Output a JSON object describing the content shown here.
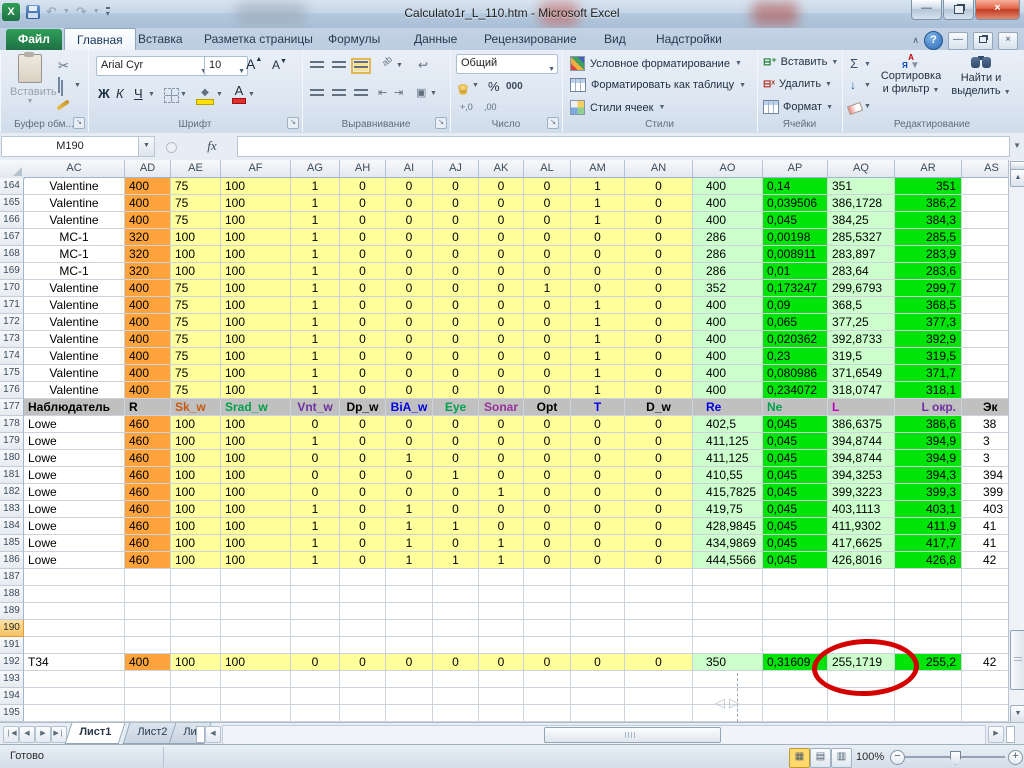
{
  "window": {
    "title": "Calculato1r_L_110.htm - Microsoft Excel"
  },
  "ribbon": {
    "tabs": [
      "Файл",
      "Главная",
      "Вставка",
      "Разметка страницы",
      "Формулы",
      "Данные",
      "Рецензирование",
      "Вид",
      "Надстройки"
    ],
    "clipboard": {
      "paste": "Вставить",
      "label": "Буфер обм..."
    },
    "font": {
      "name": "Arial Cyr",
      "size": "10",
      "bold": "Ж",
      "italic": "К",
      "underline": "Ч",
      "label": "Шрифт"
    },
    "alignment": {
      "label": "Выравнивание"
    },
    "number": {
      "format": "Общий",
      "percent": "%",
      "thousands": "000",
      "dec_inc": "+,0",
      "dec_dec": ",00",
      "label": "Число"
    },
    "styles": {
      "items": [
        "Условное форматирование",
        "Форматировать как таблицу",
        "Стили ячеек"
      ],
      "label": "Стили"
    },
    "cells": {
      "items": [
        "Вставить",
        "Удалить",
        "Формат"
      ],
      "label": "Ячейки"
    },
    "editing": {
      "sigma": "Σ",
      "sort": "Сортировка и фильтр",
      "find": "Найти и выделить",
      "label": "Редактирование"
    }
  },
  "formula_bar": {
    "name_box": "M190",
    "fx": "fx",
    "formula": ""
  },
  "sheet": {
    "columns": [
      "AC",
      "AD",
      "AE",
      "AF",
      "AG",
      "AH",
      "AI",
      "AJ",
      "AK",
      "AL",
      "AM",
      "AN",
      "AO",
      "AP",
      "AQ",
      "AR",
      "AS"
    ],
    "active_row": 190,
    "header_colors": [
      "#000000",
      "#000000",
      "#C45911",
      "#00A14B",
      "#7030A0",
      "#000000",
      "#0000E0",
      "#00A14B",
      "#99309A",
      "#000000",
      "#0000E0",
      "#000000",
      "#0000E0",
      "#00A14B",
      "#BF00BF",
      "#7030A0",
      "#000000"
    ],
    "rows": [
      {
        "n": 164,
        "a": "c",
        "v": [
          "Valentine",
          "400",
          "75",
          "100",
          "1",
          "0",
          "0",
          "0",
          "0",
          "0",
          "1",
          "0",
          "400",
          "0,14",
          "351",
          "351",
          ""
        ]
      },
      {
        "n": 165,
        "a": "c",
        "v": [
          "Valentine",
          "400",
          "75",
          "100",
          "1",
          "0",
          "0",
          "0",
          "0",
          "0",
          "1",
          "0",
          "400",
          "0,039506",
          "386,1728",
          "386,2",
          ""
        ]
      },
      {
        "n": 166,
        "a": "c",
        "v": [
          "Valentine",
          "400",
          "75",
          "100",
          "1",
          "0",
          "0",
          "0",
          "0",
          "0",
          "1",
          "0",
          "400",
          "0,045",
          "384,25",
          "384,3",
          ""
        ]
      },
      {
        "n": 167,
        "a": "c",
        "v": [
          "MC-1",
          "320",
          "100",
          "100",
          "1",
          "0",
          "0",
          "0",
          "0",
          "0",
          "0",
          "0",
          "286",
          "0,00198",
          "285,5327",
          "285,5",
          ""
        ]
      },
      {
        "n": 168,
        "a": "c",
        "v": [
          "MC-1",
          "320",
          "100",
          "100",
          "1",
          "0",
          "0",
          "0",
          "0",
          "0",
          "0",
          "0",
          "286",
          "0,008911",
          "283,897",
          "283,9",
          ""
        ]
      },
      {
        "n": 169,
        "a": "c",
        "v": [
          "MC-1",
          "320",
          "100",
          "100",
          "1",
          "0",
          "0",
          "0",
          "0",
          "0",
          "0",
          "0",
          "286",
          "0,01",
          "283,64",
          "283,6",
          ""
        ]
      },
      {
        "n": 170,
        "a": "c",
        "v": [
          "Valentine",
          "400",
          "75",
          "100",
          "1",
          "0",
          "0",
          "0",
          "0",
          "1",
          "0",
          "0",
          "352",
          "0,173247",
          "299,6793",
          "299,7",
          ""
        ]
      },
      {
        "n": 171,
        "a": "c",
        "v": [
          "Valentine",
          "400",
          "75",
          "100",
          "1",
          "0",
          "0",
          "0",
          "0",
          "0",
          "1",
          "0",
          "400",
          "0,09",
          "368,5",
          "368,5",
          ""
        ]
      },
      {
        "n": 172,
        "a": "c",
        "v": [
          "Valentine",
          "400",
          "75",
          "100",
          "1",
          "0",
          "0",
          "0",
          "0",
          "0",
          "1",
          "0",
          "400",
          "0,065",
          "377,25",
          "377,3",
          ""
        ]
      },
      {
        "n": 173,
        "a": "c",
        "v": [
          "Valentine",
          "400",
          "75",
          "100",
          "1",
          "0",
          "0",
          "0",
          "0",
          "0",
          "1",
          "0",
          "400",
          "0,020362",
          "392,8733",
          "392,9",
          ""
        ]
      },
      {
        "n": 174,
        "a": "c",
        "v": [
          "Valentine",
          "400",
          "75",
          "100",
          "1",
          "0",
          "0",
          "0",
          "0",
          "0",
          "1",
          "0",
          "400",
          "0,23",
          "319,5",
          "319,5",
          ""
        ]
      },
      {
        "n": 175,
        "a": "c",
        "v": [
          "Valentine",
          "400",
          "75",
          "100",
          "1",
          "0",
          "0",
          "0",
          "0",
          "0",
          "1",
          "0",
          "400",
          "0,080986",
          "371,6549",
          "371,7",
          ""
        ]
      },
      {
        "n": 176,
        "a": "c",
        "v": [
          "Valentine",
          "400",
          "75",
          "100",
          "1",
          "0",
          "0",
          "0",
          "0",
          "0",
          "1",
          "0",
          "400",
          "0,234072",
          "318,0747",
          "318,1",
          ""
        ]
      },
      {
        "n": 177,
        "h": true,
        "a": "l",
        "v": [
          "Наблюдатель",
          "R",
          "Sk_w",
          "Srad_w",
          "Vnt_w",
          "Dp_w",
          "BiA_w",
          "Eye",
          "Sonar",
          "Opt",
          "T",
          "D_w",
          "Re",
          "Ne",
          "L",
          "L окр.",
          "Эк"
        ]
      },
      {
        "n": 178,
        "a": "l",
        "v": [
          "Lowe",
          "460",
          "100",
          "100",
          "0",
          "0",
          "0",
          "0",
          "0",
          "0",
          "0",
          "0",
          "402,5",
          "0,045",
          "386,6375",
          "386,6",
          "38"
        ]
      },
      {
        "n": 179,
        "a": "l",
        "v": [
          "Lowe",
          "460",
          "100",
          "100",
          "1",
          "0",
          "0",
          "0",
          "0",
          "0",
          "0",
          "0",
          "411,125",
          "0,045",
          "394,8744",
          "394,9",
          "3"
        ]
      },
      {
        "n": 180,
        "a": "l",
        "v": [
          "Lowe",
          "460",
          "100",
          "100",
          "0",
          "0",
          "1",
          "0",
          "0",
          "0",
          "0",
          "0",
          "411,125",
          "0,045",
          "394,8744",
          "394,9",
          "3"
        ]
      },
      {
        "n": 181,
        "a": "l",
        "v": [
          "Lowe",
          "460",
          "100",
          "100",
          "0",
          "0",
          "0",
          "1",
          "0",
          "0",
          "0",
          "0",
          "410,55",
          "0,045",
          "394,3253",
          "394,3",
          "394"
        ]
      },
      {
        "n": 182,
        "a": "l",
        "v": [
          "Lowe",
          "460",
          "100",
          "100",
          "0",
          "0",
          "0",
          "0",
          "1",
          "0",
          "0",
          "0",
          "415,7825",
          "0,045",
          "399,3223",
          "399,3",
          "399"
        ]
      },
      {
        "n": 183,
        "a": "l",
        "v": [
          "Lowe",
          "460",
          "100",
          "100",
          "1",
          "0",
          "1",
          "0",
          "0",
          "0",
          "0",
          "0",
          "419,75",
          "0,045",
          "403,1113",
          "403,1",
          "403"
        ]
      },
      {
        "n": 184,
        "a": "l",
        "v": [
          "Lowe",
          "460",
          "100",
          "100",
          "1",
          "0",
          "1",
          "1",
          "0",
          "0",
          "0",
          "0",
          "428,9845",
          "0,045",
          "411,9302",
          "411,9",
          "41"
        ]
      },
      {
        "n": 185,
        "a": "l",
        "v": [
          "Lowe",
          "460",
          "100",
          "100",
          "1",
          "0",
          "1",
          "0",
          "1",
          "0",
          "0",
          "0",
          "434,9869",
          "0,045",
          "417,6625",
          "417,7",
          "41"
        ]
      },
      {
        "n": 186,
        "a": "l",
        "v": [
          "Lowe",
          "460",
          "100",
          "100",
          "1",
          "0",
          "1",
          "1",
          "1",
          "0",
          "0",
          "0",
          "444,5566",
          "0,045",
          "426,8016",
          "426,8",
          "42"
        ]
      },
      {
        "n": 187,
        "v": []
      },
      {
        "n": 188,
        "v": []
      },
      {
        "n": 189,
        "v": []
      },
      {
        "n": 190,
        "v": []
      },
      {
        "n": 191,
        "v": []
      },
      {
        "n": 192,
        "a": "l",
        "v": [
          "T34",
          "400",
          "100",
          "100",
          "0",
          "0",
          "0",
          "0",
          "0",
          "0",
          "0",
          "0",
          "350",
          "0,31609",
          "255,1719",
          "255,2",
          "42"
        ]
      },
      {
        "n": 193,
        "v": []
      },
      {
        "n": 194,
        "v": []
      },
      {
        "n": 195,
        "v": []
      }
    ]
  },
  "tabs_bar": {
    "sheets": [
      "Лист1",
      "Лист2",
      "Ли"
    ],
    "active": "Лист1"
  },
  "status_bar": {
    "mode": "Готово",
    "zoom": "100%"
  },
  "annotation": {
    "shape": "red-ellipse",
    "cell": "AQ192",
    "value": "255,1719"
  },
  "colors": {
    "r_fill": "#FFA33C",
    "param_fill": "#FFFF9C",
    "re_fill": "#CCFFCC",
    "ne_fill": "#00E40A",
    "header_fill": "#C0C0C0",
    "annotation_red": "#D40000",
    "file_tab_green": "#1E7145",
    "active_row_header": "#F7C260"
  }
}
